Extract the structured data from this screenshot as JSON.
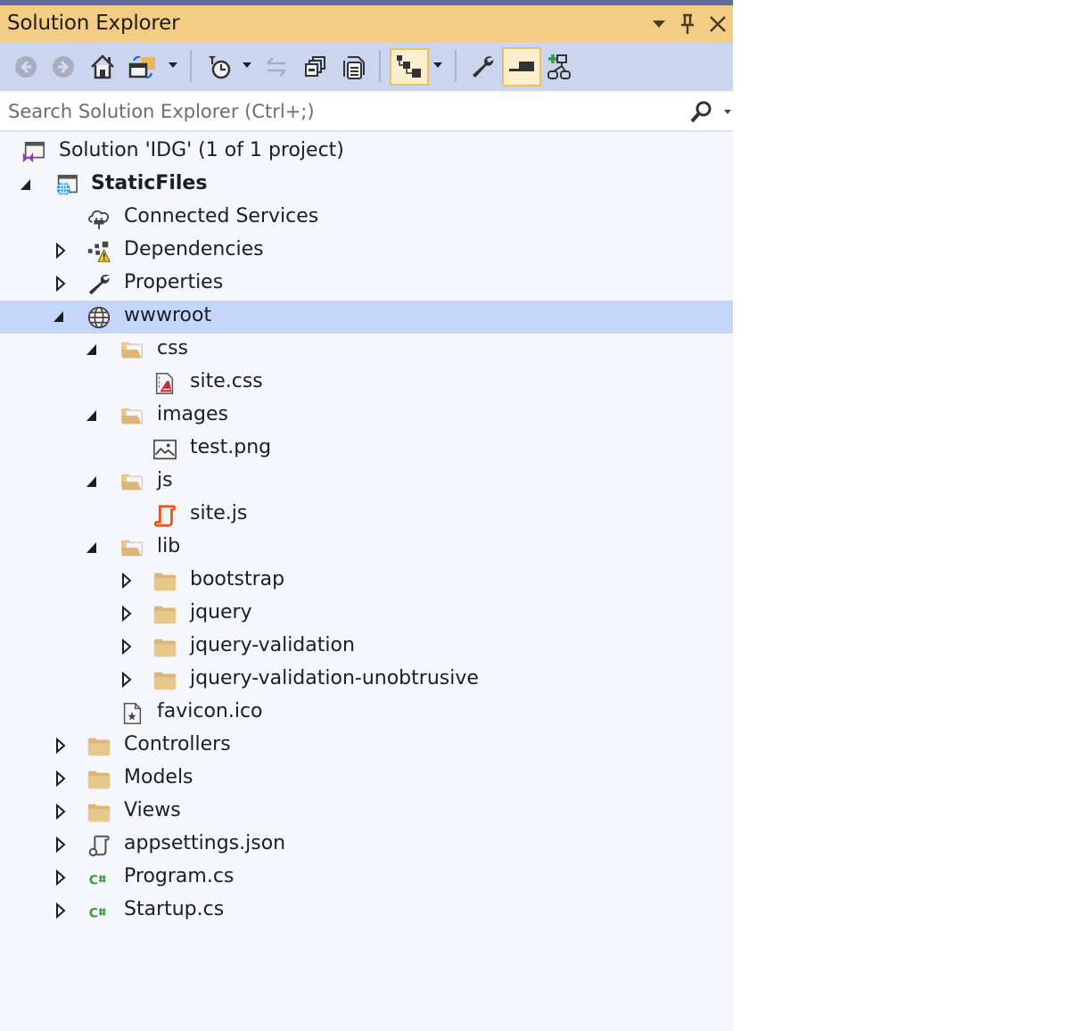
{
  "window": {
    "title": "Solution Explorer",
    "controls": [
      {
        "name": "window-position-dropdown",
        "icon": "chevron-down-icon"
      },
      {
        "name": "pin",
        "icon": "pin-icon"
      },
      {
        "name": "close",
        "icon": "close-icon"
      }
    ]
  },
  "toolbar": {
    "buttons": [
      {
        "name": "back",
        "icon": "back-arrow-icon",
        "enabled": false
      },
      {
        "name": "forward",
        "icon": "forward-arrow-icon",
        "enabled": false
      },
      {
        "name": "home",
        "icon": "home-icon",
        "enabled": true
      },
      {
        "name": "switch-views",
        "icon": "switch-views-icon",
        "enabled": true,
        "has_dropdown": true
      },
      {
        "name": "pending-changes-filter",
        "icon": "clock-filter-icon",
        "enabled": true,
        "has_dropdown": true
      },
      {
        "name": "sync-with-active-document",
        "icon": "sync-arrows-icon",
        "enabled": false
      },
      {
        "name": "collapse-all",
        "icon": "collapse-all-icon",
        "enabled": true
      },
      {
        "name": "show-all-files",
        "icon": "show-all-files-icon",
        "enabled": true
      },
      {
        "name": "view-hierarchy",
        "icon": "hierarchy-icon",
        "enabled": true,
        "active": true,
        "has_dropdown": true
      },
      {
        "name": "properties",
        "icon": "wrench-icon",
        "enabled": true
      },
      {
        "name": "preview-selected-items",
        "icon": "preview-icon",
        "enabled": true,
        "active": true
      },
      {
        "name": "add-class-diagram",
        "icon": "class-diagram-icon",
        "enabled": true
      }
    ]
  },
  "search": {
    "placeholder": "Search Solution Explorer (Ctrl+;)",
    "value": ""
  },
  "tree": {
    "selected": "wwwroot",
    "accent_color": "#c5d6fb",
    "items": [
      {
        "label": "Solution 'IDG' (1 of 1 project)",
        "level": 0,
        "icon": "solution-icon",
        "expander": "none"
      },
      {
        "label": "StaticFiles",
        "level": 1,
        "icon": "web-project-icon",
        "expander": "expanded",
        "bold": true
      },
      {
        "label": "Connected Services",
        "level": 2,
        "icon": "connected-services-icon",
        "expander": "none"
      },
      {
        "label": "Dependencies",
        "level": 2,
        "icon": "dependencies-warning-icon",
        "expander": "collapsed"
      },
      {
        "label": "Properties",
        "level": 2,
        "icon": "wrench-icon",
        "expander": "collapsed"
      },
      {
        "label": "wwwroot",
        "level": 2,
        "icon": "globe-icon",
        "expander": "expanded"
      },
      {
        "label": "css",
        "level": 3,
        "icon": "folder-open-icon",
        "expander": "expanded"
      },
      {
        "label": "site.css",
        "level": 4,
        "icon": "css-file-icon",
        "expander": "none"
      },
      {
        "label": "images",
        "level": 3,
        "icon": "folder-open-icon",
        "expander": "expanded"
      },
      {
        "label": "test.png",
        "level": 4,
        "icon": "image-file-icon",
        "expander": "none"
      },
      {
        "label": "js",
        "level": 3,
        "icon": "folder-open-icon",
        "expander": "expanded"
      },
      {
        "label": "site.js",
        "level": 4,
        "icon": "js-file-icon",
        "expander": "none"
      },
      {
        "label": "lib",
        "level": 3,
        "icon": "folder-open-icon",
        "expander": "expanded"
      },
      {
        "label": "bootstrap",
        "level": 4,
        "icon": "folder-icon",
        "expander": "collapsed"
      },
      {
        "label": "jquery",
        "level": 4,
        "icon": "folder-icon",
        "expander": "collapsed"
      },
      {
        "label": "jquery-validation",
        "level": 4,
        "icon": "folder-icon",
        "expander": "collapsed"
      },
      {
        "label": "jquery-validation-unobtrusive",
        "level": 4,
        "icon": "folder-icon",
        "expander": "collapsed"
      },
      {
        "label": "favicon.ico",
        "level": 3,
        "icon": "icon-file-icon",
        "expander": "none"
      },
      {
        "label": "Controllers",
        "level": 2,
        "icon": "folder-icon",
        "expander": "collapsed"
      },
      {
        "label": "Models",
        "level": 2,
        "icon": "folder-icon",
        "expander": "collapsed"
      },
      {
        "label": "Views",
        "level": 2,
        "icon": "folder-icon",
        "expander": "collapsed"
      },
      {
        "label": "appsettings.json",
        "level": 2,
        "icon": "json-file-icon",
        "expander": "collapsed"
      },
      {
        "label": "Program.cs",
        "level": 2,
        "icon": "csharp-file-icon",
        "expander": "collapsed"
      },
      {
        "label": "Startup.cs",
        "level": 2,
        "icon": "csharp-file-icon",
        "expander": "collapsed"
      }
    ]
  }
}
